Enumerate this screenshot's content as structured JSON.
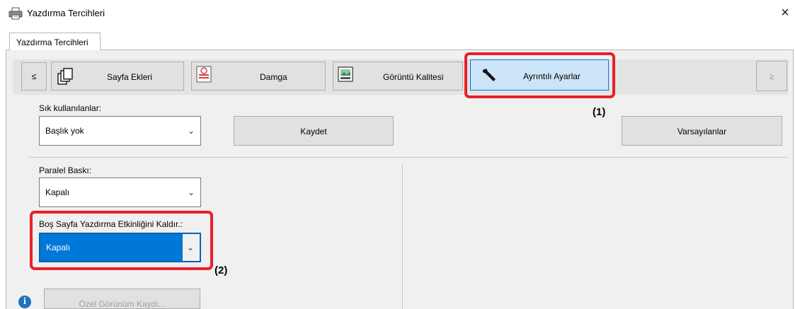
{
  "window": {
    "title": "Yazdırma Tercihleri",
    "close_glyph": "×"
  },
  "tab": {
    "label": "Yazdırma Tercihleri"
  },
  "toolbar": {
    "prev_glyph": "≤",
    "next_glyph": "≥",
    "tiles": [
      {
        "label": "Sayfa Ekleri",
        "icon": "pages-icon"
      },
      {
        "label": "Damga",
        "icon": "stamp-icon"
      },
      {
        "label": "Görüntü Kalitesi",
        "icon": "image-quality-icon"
      },
      {
        "label": "Ayrıntılı Ayarlar",
        "icon": "wrench-icon",
        "active": true
      }
    ]
  },
  "favorites": {
    "label": "Sık kullanılanlar:",
    "value": "Başlık yok",
    "save_label": "Kaydet",
    "defaults_label": "Varsayılanlar"
  },
  "parallel": {
    "label": "Paralel Baskı:",
    "value": "Kapalı"
  },
  "blank_page": {
    "label": "Boş Sayfa Yazdırma Etkinliğini Kaldır.:",
    "value": "Kapalı"
  },
  "custom_view": {
    "label": "Özel Görünüm Kaydı..."
  },
  "callouts": {
    "one": "(1)",
    "two": "(2)"
  },
  "colors": {
    "highlight": "#0078d7",
    "callout_red": "#e8202a",
    "active_tile": "#cce4f7"
  }
}
